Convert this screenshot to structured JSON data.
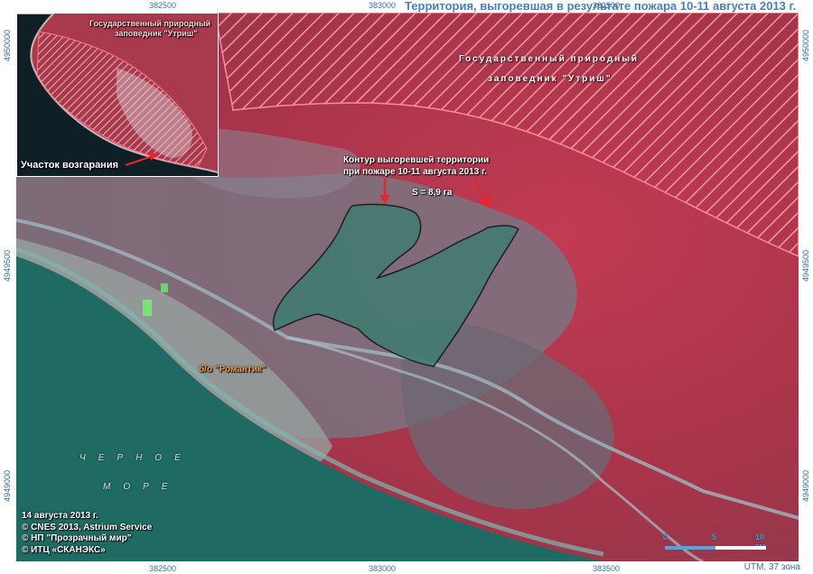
{
  "title": "Территория, выгоревшая в результате пожара 10-11 августа 2013 г.",
  "utm_note": "UTM, 37 зона",
  "grid": {
    "x_labels": [
      "382500",
      "383000",
      "383500"
    ],
    "y_labels": [
      "4950000",
      "4949500",
      "4949000"
    ]
  },
  "labels": {
    "reserve_line1": "Государственный природный",
    "reserve_line2": "заповедник \"Утриш\"",
    "burn_line1": "Контур выгоревшей территории",
    "burn_line2": "при пожаре 10-11 августа 2013 г.",
    "area": "S = 8,9 га",
    "resort": "б/о \"Романтик\"",
    "sea_line1": "ЧЕРНОЕ",
    "sea_line2": "МОРЕ"
  },
  "inset": {
    "reserve_line1": "Государственный природный",
    "reserve_line2": "заповедник \"Утриш\"",
    "fire_site": "Участок возгарания"
  },
  "credits": {
    "date": "14 августа 2013 г.",
    "line1": "© CNES 2013, Astrium Service",
    "line2": "© НП \"Прозрачный мир\"",
    "line3": "© ИТЦ «СКАНЭКС»"
  },
  "scale_bar": {
    "ticks": [
      "0",
      "5",
      "10 км"
    ]
  },
  "colors": {
    "reserve_hatch": "#ff6f7a",
    "burn_fill": "#3f7c6f",
    "sea": "#1e6b64",
    "vegetation": "#b5364a",
    "coord_text": "#3a6f9e",
    "title_text": "#4a7fb8",
    "resort_label": "#f29a4a"
  }
}
